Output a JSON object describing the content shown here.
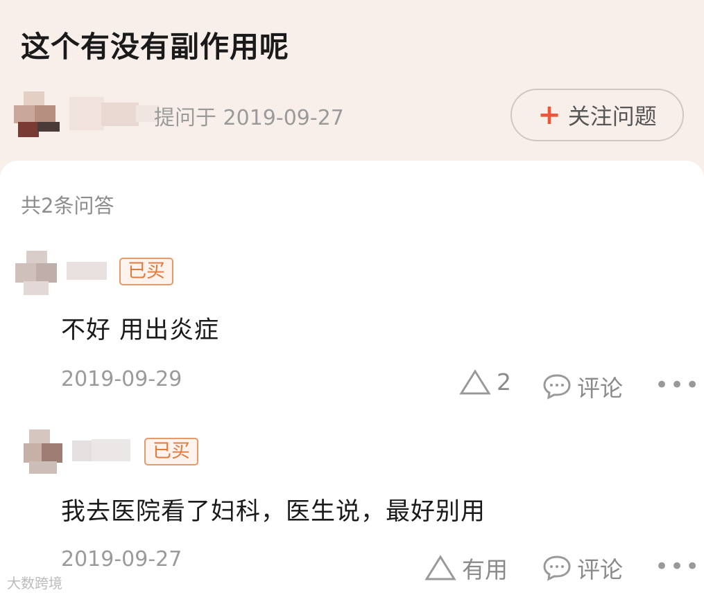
{
  "question": {
    "title": "这个有没有副作用呢",
    "asked_text": "提问于 2019-09-27",
    "follow_label": "关注问题"
  },
  "answers_count": "共2条问答",
  "answers": [
    {
      "badge": "已买",
      "text": "不好  用出炎症",
      "date": "2019-09-29",
      "useful_count": "2",
      "comment_label": "评论",
      "more_label": "•••"
    },
    {
      "badge": "已买",
      "text": "我去医院看了妇科，医生说，最好别用",
      "date": "2019-09-27",
      "useful_label": "有用",
      "comment_label": "评论",
      "more_label": "•••"
    }
  ],
  "watermark": "大数跨境",
  "colors": {
    "accent": "#e8573a",
    "badge_text": "#e07a3c",
    "badge_border": "#e59a6c",
    "header_bg": "#f9efea"
  }
}
